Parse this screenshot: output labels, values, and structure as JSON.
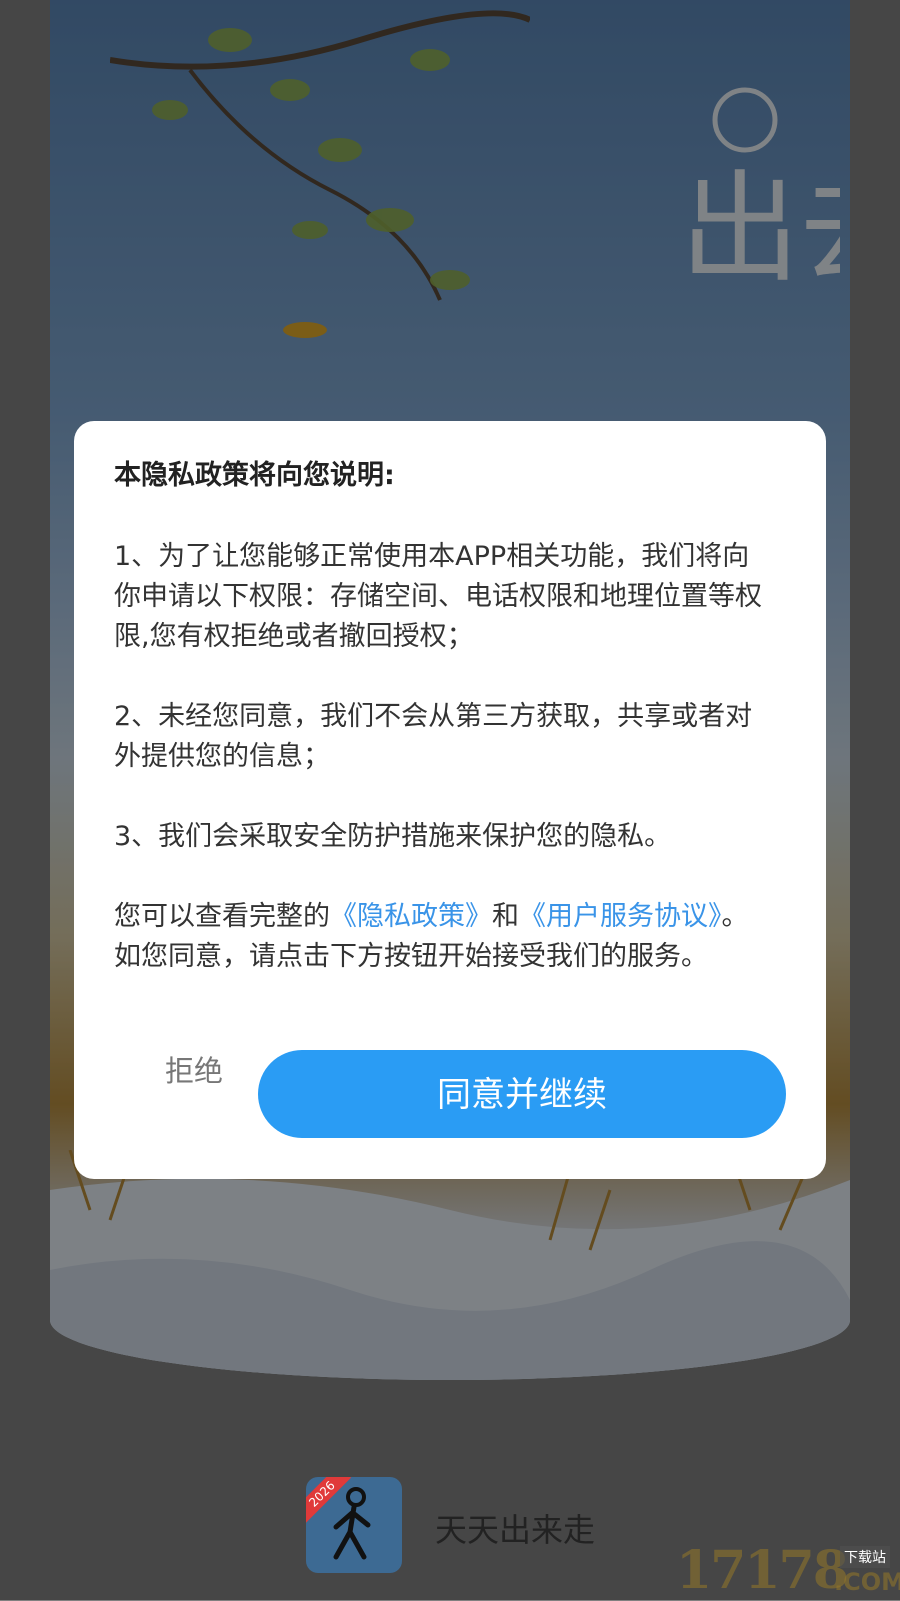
{
  "splash": {
    "title_art_text": "出去走"
  },
  "dialog": {
    "title": "本隐私政策将向您说明:",
    "item1": "1、为了让您能够正常使用本APP相关功能，我们将向你申请以下权限：存储空间、电话权限和地理位置等权限,您有权拒绝或者撤回授权；",
    "item2": "2、未经您同意，我们不会从第三方获取，共享或者对外提供您的信息；",
    "item3": "3、我们会采取安全防护措施来保护您的隐私。",
    "notice_prefix": "您可以查看完整的",
    "privacy_link": "《隐私政策》",
    "notice_and": "和",
    "service_link": "《用户服务协议》",
    "notice_suffix": "。如您同意，请点击下方按钮开始接受我们的服务。",
    "reject_label": "拒绝",
    "agree_label": "同意并继续"
  },
  "footer": {
    "logo_badge": "2026",
    "app_name": "天天出来走",
    "watermark": "17178",
    "watermark_sub": "下载站",
    "watermark_com": ".COM"
  },
  "colors": {
    "accent": "#2a9cf4",
    "link": "#3a94e8"
  }
}
